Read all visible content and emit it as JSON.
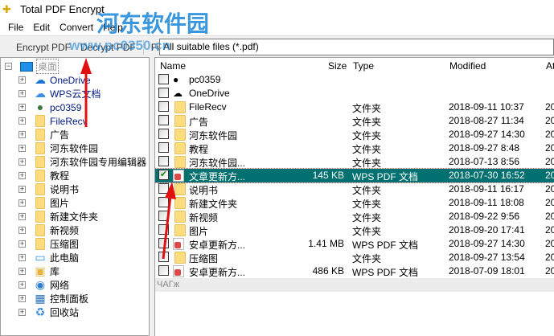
{
  "window": {
    "title": "Total PDF Encrypt"
  },
  "menu": [
    "File",
    "Edit",
    "Convert",
    "Help"
  ],
  "toolbar": {
    "encrypt": "Encrypt PDF",
    "decrypt": "Decrypt PDF",
    "filter_label": "Filter:",
    "filter_value": "All suitable files (*.pdf)"
  },
  "tree": {
    "root": "桌面",
    "items": [
      {
        "label": "OneDrive",
        "icon": "onedrive"
      },
      {
        "label": "WPS云文档",
        "icon": "cloud"
      },
      {
        "label": "pc0359",
        "icon": "user"
      },
      {
        "label": "FileRecv",
        "icon": "folder"
      },
      {
        "label": "广告",
        "icon": "folder"
      },
      {
        "label": "河东软件园",
        "icon": "folder"
      },
      {
        "label": "河东软件园专用编辑器",
        "icon": "folder"
      },
      {
        "label": "教程",
        "icon": "folder"
      },
      {
        "label": "说明书",
        "icon": "folder"
      },
      {
        "label": "图片",
        "icon": "folder"
      },
      {
        "label": "新建文件夹",
        "icon": "folder"
      },
      {
        "label": "新视频",
        "icon": "folder"
      },
      {
        "label": "压缩图",
        "icon": "folder"
      },
      {
        "label": "此电脑",
        "icon": "computer"
      },
      {
        "label": "库",
        "icon": "library"
      },
      {
        "label": "网络",
        "icon": "network"
      },
      {
        "label": "控制面板",
        "icon": "control-panel"
      },
      {
        "label": "回收站",
        "icon": "recycle-bin"
      }
    ]
  },
  "list": {
    "columns": {
      "name": "Name",
      "size": "Size",
      "type": "Type",
      "modified": "Modified",
      "attr": "At"
    },
    "rows": [
      {
        "name": "pc0359",
        "size": "",
        "type": "",
        "modified": "",
        "attr": "",
        "icon": "user",
        "checked": false
      },
      {
        "name": "OneDrive",
        "size": "",
        "type": "",
        "modified": "",
        "attr": "",
        "icon": "onedrive",
        "checked": false
      },
      {
        "name": "FileRecv",
        "size": "",
        "type": "文件夹",
        "modified": "2018-09-11 10:37",
        "attr": "20",
        "icon": "folder",
        "checked": false
      },
      {
        "name": "广告",
        "size": "",
        "type": "文件夹",
        "modified": "2018-08-27 11:34",
        "attr": "20",
        "icon": "folder",
        "checked": false
      },
      {
        "name": "河东软件园",
        "size": "",
        "type": "文件夹",
        "modified": "2018-09-27 14:30",
        "attr": "20",
        "icon": "folder",
        "checked": false
      },
      {
        "name": "教程",
        "size": "",
        "type": "文件夹",
        "modified": "2018-09-27 8:48",
        "attr": "20",
        "icon": "folder",
        "checked": false
      },
      {
        "name": "河东软件园...",
        "size": "",
        "type": "文件夹",
        "modified": "2018-07-13 8:56",
        "attr": "20",
        "icon": "folder",
        "checked": false
      },
      {
        "name": "文章更新方...",
        "size": "145 KB",
        "type": "WPS PDF 文档",
        "modified": "2018-07-30 16:52",
        "attr": "20",
        "icon": "pdf",
        "checked": true,
        "selected": true
      },
      {
        "name": "说明书",
        "size": "",
        "type": "文件夹",
        "modified": "2018-09-11 16:17",
        "attr": "20",
        "icon": "folder",
        "checked": false
      },
      {
        "name": "新建文件夹",
        "size": "",
        "type": "文件夹",
        "modified": "2018-09-11 18:08",
        "attr": "20",
        "icon": "folder",
        "checked": false
      },
      {
        "name": "新视频",
        "size": "",
        "type": "文件夹",
        "modified": "2018-09-22 9:56",
        "attr": "20",
        "icon": "folder",
        "checked": false
      },
      {
        "name": "图片",
        "size": "",
        "type": "文件夹",
        "modified": "2018-09-20 17:41",
        "attr": "20",
        "icon": "folder",
        "checked": false
      },
      {
        "name": "安卓更新方...",
        "size": "1.41 MB",
        "type": "WPS PDF 文档",
        "modified": "2018-09-27 14:30",
        "attr": "20",
        "icon": "pdf",
        "checked": false
      },
      {
        "name": "压缩图",
        "size": "",
        "type": "文件夹",
        "modified": "2018-09-27 13:54",
        "attr": "20",
        "icon": "folder",
        "checked": false
      },
      {
        "name": "安卓更新方...",
        "size": "486 KB",
        "type": "WPS PDF 文档",
        "modified": "2018-07-09 18:01",
        "attr": "20",
        "icon": "pdf",
        "checked": false
      }
    ],
    "footer": "ЧАГж"
  },
  "watermark": {
    "logo_text": "河东软件园",
    "url": "www.pc0350.cn"
  },
  "colors": {
    "selection": "#007070",
    "arrow": "#e01010"
  }
}
